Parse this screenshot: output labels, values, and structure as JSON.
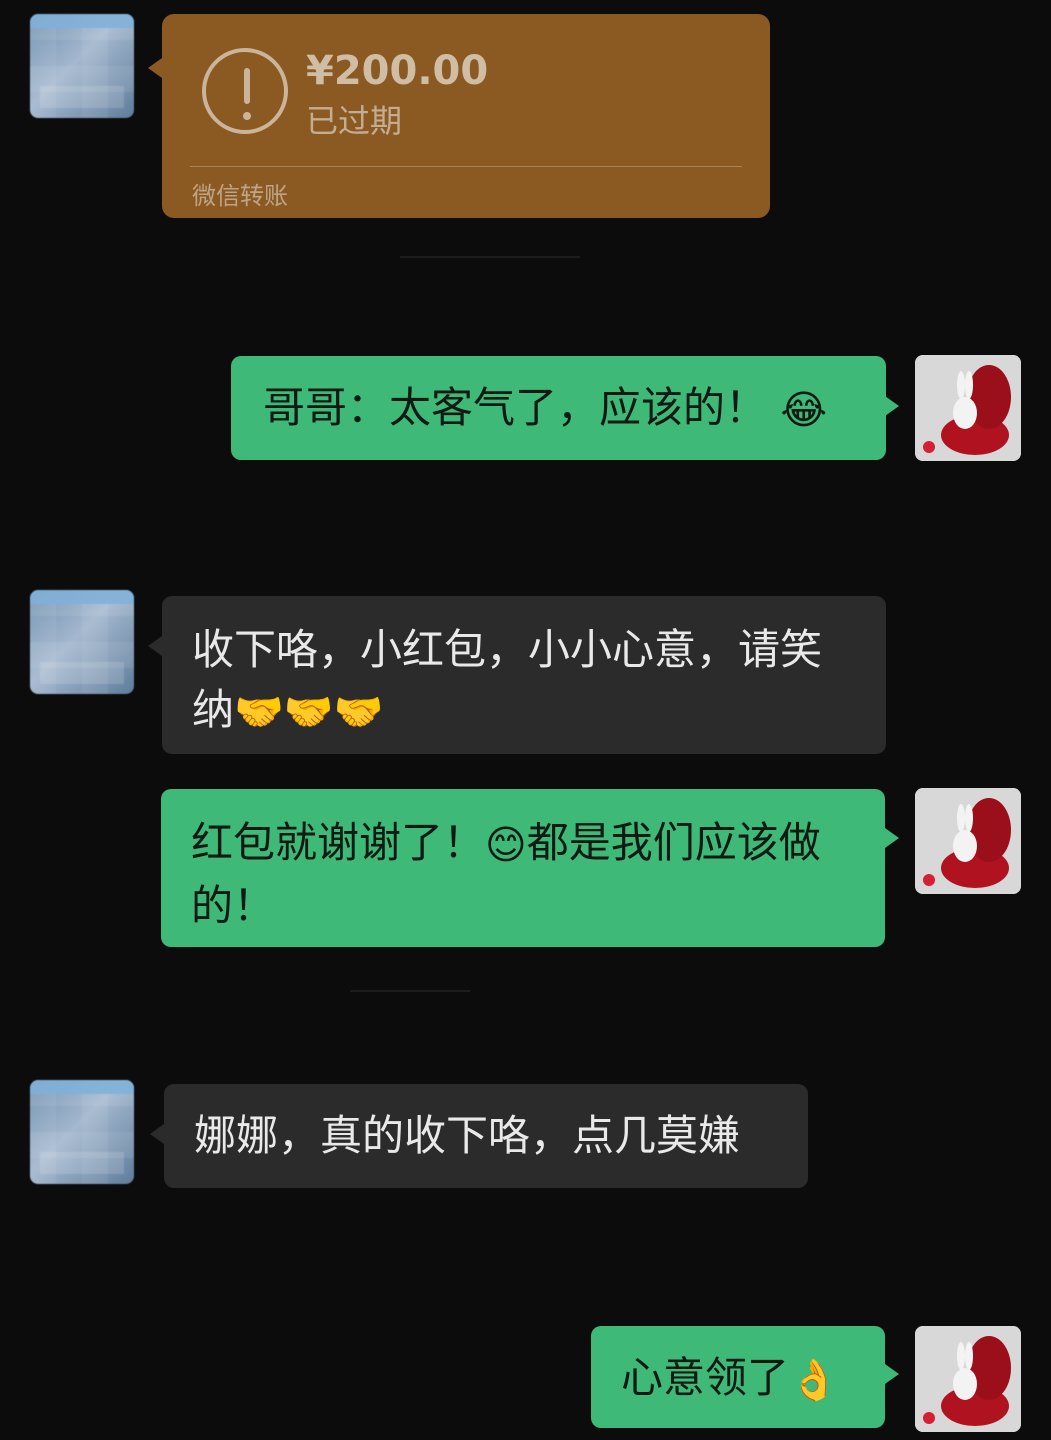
{
  "transfer": {
    "amount": "¥200.00",
    "status": "已过期",
    "label": "微信转账"
  },
  "messages": [
    {
      "side": "right",
      "text": "哥哥：太客气了，应该的！",
      "emoji": "😂"
    },
    {
      "side": "left",
      "text": "收下咯，小红包，小小心意，请笑纳",
      "emoji": "🤝🤝🤝"
    },
    {
      "side": "right",
      "text": "红包就谢谢了！",
      "emoji_mid": "😊",
      "text_after": "都是我们应该做的！"
    },
    {
      "side": "left",
      "text": "娜娜，真的收下咯，点几莫嫌"
    },
    {
      "side": "right",
      "text": "心意领了",
      "emoji": "👌"
    }
  ],
  "colors": {
    "background": "#0c0c0c",
    "green_bubble": "#3fb978",
    "dark_bubble": "#2b2b2b",
    "transfer_card": "#8a5a22"
  },
  "icons": {
    "transfer_status": "exclamation-circle-icon",
    "left_avatar": "pixelated-avatar-icon",
    "right_avatar": "rabbit-apple-avatar-icon"
  }
}
